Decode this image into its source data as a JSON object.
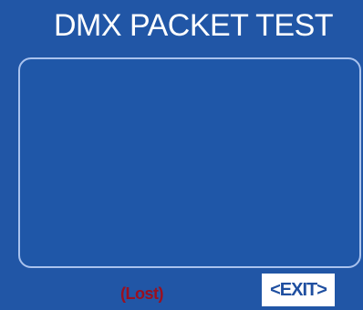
{
  "header": {
    "title": "DMX PACKET TEST"
  },
  "status": {
    "text": "(Lost)"
  },
  "buttons": {
    "exit_label": "<EXIT>"
  },
  "colors": {
    "background": "#2156a6",
    "panel_border": "#a9c2ee",
    "status_text": "#9a1020",
    "button_bg": "#ffffff",
    "button_text": "#1f4fa0"
  }
}
